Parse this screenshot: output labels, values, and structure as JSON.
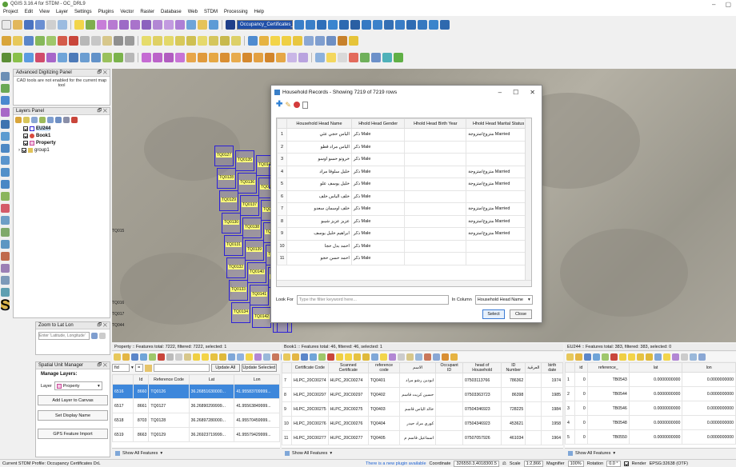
{
  "window": {
    "title": "QGIS 3.16.4 for STDM - OC_DRL9"
  },
  "menu": [
    "Project",
    "Edit",
    "View",
    "Layer",
    "Settings",
    "Plugins",
    "Vector",
    "Raster",
    "Database",
    "Web",
    "STDM",
    "Processing",
    "Help"
  ],
  "toolbar": {
    "combo": "Occupancy_Certificates_DRL"
  },
  "colors": {
    "accent": "#3d87db",
    "parcel": "#2e22d6",
    "label_bg": "#ffff7a"
  },
  "digitizing": {
    "title": "Advanced Digitizing Panel",
    "message": "CAD tools are not enabled for the current map tool"
  },
  "layers": {
    "title": "Layers Panel",
    "items": [
      {
        "name": "EU244",
        "bold": true
      },
      {
        "name": "Book1",
        "bold": true
      },
      {
        "name": "Property",
        "bold": true
      },
      {
        "name": "group1",
        "bold": false
      }
    ]
  },
  "zoomto": {
    "title": "Zoom to Lat Lon",
    "placeholder": "Enter 'Latitude, Longitude'"
  },
  "spatial": {
    "title": "Spatial Unit Manager",
    "manage": "Manage Layers:",
    "layer_label": "Layer",
    "layer_value": "Property",
    "add_btn": "Add Layer to Canvas",
    "set_btn": "Set Display Name",
    "gps_btn": "GPS Feature Import"
  },
  "map_labels": [
    "TQ0127",
    "TQ0128",
    "TQ0129",
    "TQ0130",
    "TQ0131",
    "TQ0132",
    "TQ0133",
    "TQ0134",
    "TQ0135",
    "TQ0136",
    "TQ0137",
    "TQ0138",
    "TQ0139",
    "TQ0140",
    "TQ0141",
    "TQ0142",
    "TQ0143",
    "TQ0144",
    "TQ0145",
    "TQ0146",
    "TQ0147",
    "TQ0148"
  ],
  "map_side_labels": [
    "TQ015",
    "TQ016",
    "TQ017",
    "TQ044"
  ],
  "household": {
    "title": "Household Records - Showing 7219 of 7219 rows",
    "columns": [
      "Household Head Name",
      "Hhold Head Gender",
      "Hhold Head Birth Year",
      "Hhold Head Marital Status"
    ],
    "rows": [
      {
        "n": "1",
        "name": "الياس حجي عثي",
        "gender": "ذكر Male",
        "birth": "",
        "marital": "متزوج/متزوجة Married"
      },
      {
        "n": "2",
        "name": "الياس مراد قطو",
        "gender": "ذكر Male",
        "birth": "",
        "marital": ""
      },
      {
        "n": "3",
        "name": "خروتو حسو اوسو",
        "gender": "ذكر Male",
        "birth": "",
        "marital": ""
      },
      {
        "n": "4",
        "name": "خليل سلوقا مراد",
        "gender": "ذكر Male",
        "birth": "",
        "marital": "متزوج/متزوجة Married"
      },
      {
        "n": "5",
        "name": "خليل يوسف علو",
        "gender": "ذكر Male",
        "birth": "",
        "marital": "متزوج/متزوجة Married"
      },
      {
        "n": "6",
        "name": "خلف الياس خلف",
        "gender": "ذكر Male",
        "birth": "",
        "marital": ""
      },
      {
        "n": "7",
        "name": "خلف اوسمان سعدو",
        "gender": "ذكر Male",
        "birth": "",
        "marital": "متزوج/متزوجة Married"
      },
      {
        "n": "8",
        "name": "عزيز عزيز شيبو",
        "gender": "ذكر Male",
        "birth": "",
        "marital": "متزوج/متزوجة Married"
      },
      {
        "n": "9",
        "name": "ابراهيم خليل يوسف",
        "gender": "ذكر Male",
        "birth": "",
        "marital": "متزوج/متزوجة Married"
      },
      {
        "n": "10",
        "name": "احمد بدل حجا",
        "gender": "ذكر Male",
        "birth": "",
        "marital": ""
      },
      {
        "n": "11",
        "name": "احمد حسن حجو",
        "gender": "ذكر Male",
        "birth": "",
        "marital": ""
      }
    ],
    "lookfor": "Look For",
    "filter_placeholder": "Type the filter keyword here...",
    "incolumn": "In Column",
    "column_value": "Household Head Name",
    "select": "Select",
    "close": "Close"
  },
  "property_table": {
    "title": "Property :: Features total: 7222, filtered: 7222, selected: 1",
    "field": "fid",
    "update_all": "Update All",
    "update_selected": "Update Selected",
    "columns": [
      "",
      "Id",
      "Reference Code",
      "Lat",
      "Lon"
    ],
    "rows": [
      {
        "rn": "6516",
        "id": "8660",
        "ref": "TQ0126",
        "lat": "36.26851630000...",
        "lon": "41.95583709999...",
        "sel": true
      },
      {
        "rn": "6517",
        "id": "8661",
        "ref": "TQ0127",
        "lat": "36.26890299999...",
        "lon": "41.95563849999...",
        "sel": false
      },
      {
        "rn": "6518",
        "id": "8703",
        "ref": "TQ0128",
        "lat": "36.26897280000...",
        "lon": "41.95570459999...",
        "sel": false
      },
      {
        "rn": "6519",
        "id": "8663",
        "ref": "TQ0129",
        "lat": "36.26923719999...",
        "lon": "41.95579429999...",
        "sel": false
      }
    ],
    "show_all": "Show All Features"
  },
  "book_table": {
    "title": "Book1 :: Features total: 46, filtered: 46, selected: 1",
    "columns": [
      "",
      "Certificate Code",
      "Scanned Certificate",
      "reference code",
      "الاسم",
      "Occupant ID",
      "head of Household",
      "ID Number",
      "العرقية",
      "birth date"
    ],
    "rows": [
      {
        "rn": "7",
        "cc": "HLPC_20C00274",
        "sc": "HLPC_20C00274",
        "rc": "TQ0401",
        "name": "ابودين رشو مراد",
        "occ": "",
        "hoh": "07503113766",
        "idn": "786362",
        "eth": "",
        "bd": "1974"
      },
      {
        "rn": "8",
        "cc": "HLPC_20C00297",
        "sc": "HLPC_20C00297",
        "rc": "TQ0402",
        "name": "حسين كريت قاسم",
        "occ": "",
        "hoh": "07503363723",
        "idn": "86398",
        "eth": "",
        "bd": "1985"
      },
      {
        "rn": "9",
        "cc": "HLPC_20C00275",
        "sc": "HLPC_20C00275",
        "rc": "TQ0403",
        "name": "خالد الياس قاسم",
        "occ": "",
        "hoh": "07504346923",
        "idn": "728225",
        "eth": "",
        "bd": "1984"
      },
      {
        "rn": "10",
        "cc": "HLPC_20C00276",
        "sc": "HLPC_20C00276",
        "rc": "TQ0404",
        "name": "كوري مراد حيدر",
        "occ": "",
        "hoh": "07504346923",
        "idn": "453621",
        "eth": "",
        "bd": "1958"
      },
      {
        "rn": "11",
        "cc": "HLPC_20C00277",
        "sc": "HLPC_20C00277",
        "rc": "TQ0405",
        "name": "اسماعيل قاسم م",
        "occ": "",
        "hoh": "07507057926",
        "idn": "461034",
        "eth": "",
        "bd": "1964"
      }
    ],
    "show_all": "Show All Features"
  },
  "eu_table": {
    "title": "EU244 :: Features total: 383, filtered: 383, selected: 0",
    "columns": [
      "",
      "id",
      "reference_",
      "lat",
      "lon"
    ],
    "rows": [
      {
        "rn": "1",
        "id": "0",
        "ref": "TB0543",
        "lat": "0.0000000000",
        "lon": "0.0000000000"
      },
      {
        "rn": "2",
        "id": "0",
        "ref": "TB0544",
        "lat": "0.0000000000",
        "lon": "0.0000000000"
      },
      {
        "rn": "3",
        "id": "0",
        "ref": "TB0546",
        "lat": "0.0000000000",
        "lon": "0.0000000000"
      },
      {
        "rn": "4",
        "id": "0",
        "ref": "TB0548",
        "lat": "0.0000000000",
        "lon": "0.0000000000"
      },
      {
        "rn": "5",
        "id": "0",
        "ref": "TB0550",
        "lat": "0.0000000000",
        "lon": "0.0000000000"
      }
    ],
    "show_all": "Show All Features"
  },
  "statusbar": {
    "profile": "Current STDM Profile: Occupancy Certificates DrL",
    "plugin": "There is a new plugin available",
    "coord_label": "Coordinate",
    "coord": "326550.3,4018300.5",
    "scale_label": "Scale",
    "scale": "1:2,866",
    "magnifier_label": "Magnifier",
    "magnifier": "100%",
    "rotation_label": "Rotation",
    "rotation": "0.0 °",
    "render": "Render",
    "crs": "EPSG:32638 (OTF)"
  },
  "side_letter": "s"
}
